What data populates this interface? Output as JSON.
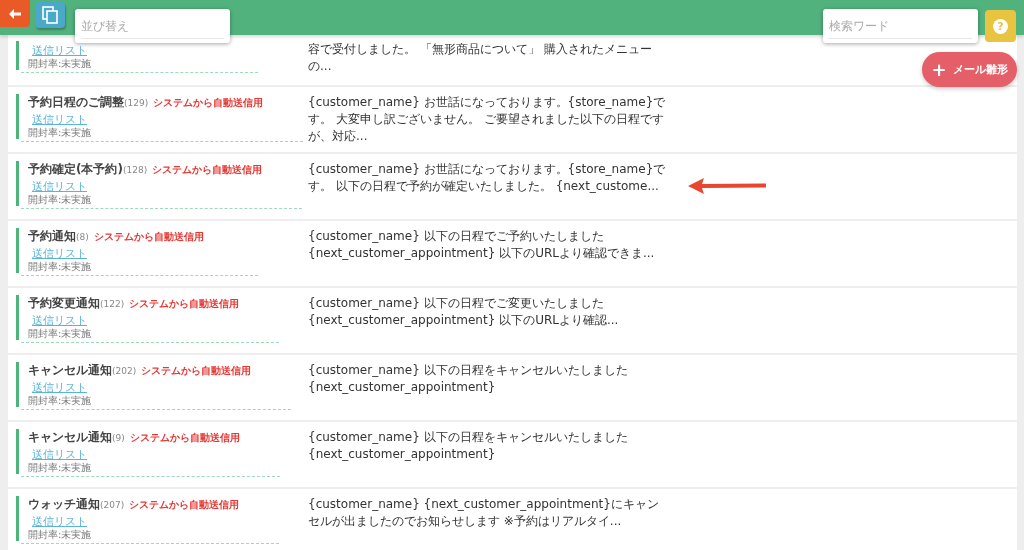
{
  "toolbar": {
    "sort_field": {
      "placeholder": "並び替え"
    },
    "search_field": {
      "placeholder": "検索ワード"
    },
    "help_label": "?"
  },
  "add_button": {
    "icon": "+",
    "label": "メール雛形"
  },
  "rows": [
    {
      "title": "",
      "count": "",
      "badge": "",
      "link": "送信リスト",
      "open_rate": "開封率:未実施",
      "preview": "容で受付しました。 「無形商品について」 購入されたメニューの...",
      "highlighted": false
    },
    {
      "title": "予約日程のご調整",
      "count": "(129)",
      "badge": "システムから自動送信用",
      "link": "送信リスト",
      "open_rate": "開封率:未実施",
      "preview": "{customer_name} お世話になっております。{store_name}です。 大変申し訳ございません。 ご要望されました以下の日程ですが、対応...",
      "highlighted": false
    },
    {
      "title": "予約確定(本予約)",
      "count": "(128)",
      "badge": "システムから自動送信用",
      "link": "送信リスト",
      "open_rate": "開封率:未実施",
      "preview": "{customer_name} お世話になっております。{store_name}です。 以下の日程で予約が確定いたしました。 {next_custome...",
      "highlighted": true
    },
    {
      "title": "予約通知",
      "count": "(8)",
      "badge": "システムから自動送信用",
      "link": "送信リスト",
      "open_rate": "開封率:未実施",
      "preview": "{customer_name} 以下の日程でご予約いたしました {next_customer_appointment} 以下のURLより確認できま...",
      "highlighted": false
    },
    {
      "title": "予約変更通知",
      "count": "(122)",
      "badge": "システムから自動送信用",
      "link": "送信リスト",
      "open_rate": "開封率:未実施",
      "preview": "{customer_name} 以下の日程でご変更いたしました {next_customer_appointment} 以下のURLより確認...",
      "highlighted": false
    },
    {
      "title": "キャンセル通知",
      "count": "(202)",
      "badge": "システムから自動送信用",
      "link": "送信リスト",
      "open_rate": "開封率:未実施",
      "preview": "{customer_name} 以下の日程をキャンセルいたしました {next_customer_appointment}",
      "highlighted": false
    },
    {
      "title": "キャンセル通知",
      "count": "(9)",
      "badge": "システムから自動送信用",
      "link": "送信リスト",
      "open_rate": "開封率:未実施",
      "preview": "{customer_name} 以下の日程をキャンセルいたしました {next_customer_appointment}",
      "highlighted": false
    },
    {
      "title": "ウォッチ通知",
      "count": "(207)",
      "badge": "システムから自動送信用",
      "link": "送信リスト",
      "open_rate": "開封率:未実施",
      "preview": "{customer_name} {next_customer_appointment}にキャンセルが出ましたのでお知らせします ※予約はリアルタイ...",
      "highlighted": false
    }
  ]
}
